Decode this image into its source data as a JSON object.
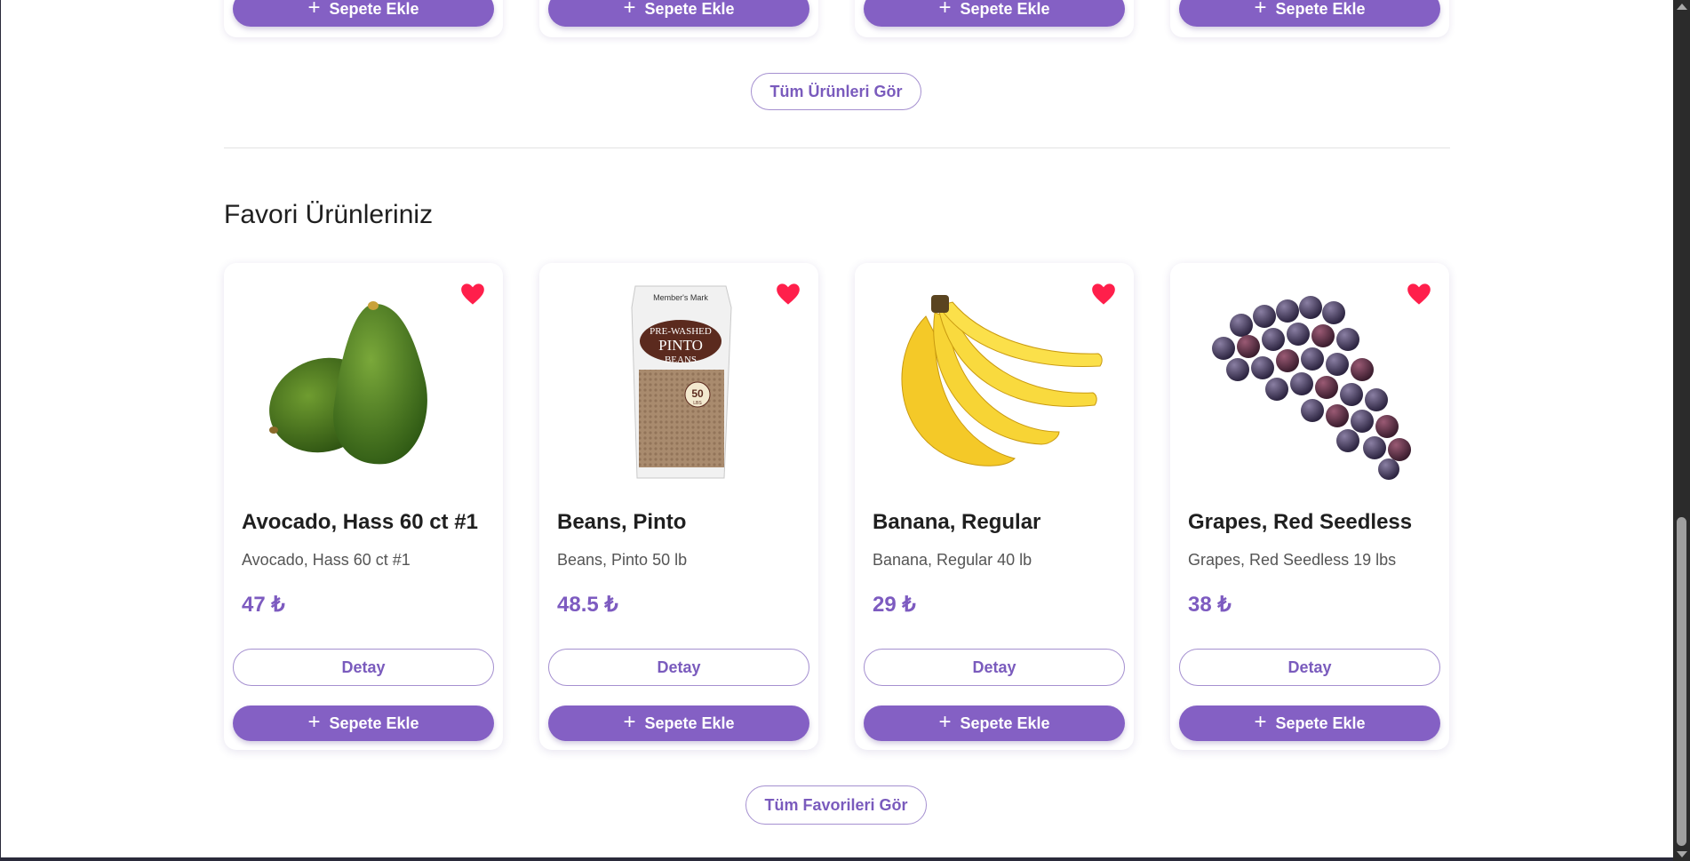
{
  "top_products": {
    "cart_buttons": [
      "Sepete Ekle",
      "Sepete Ekle",
      "Sepete Ekle",
      "Sepete Ekle"
    ],
    "see_all_label": "Tüm Ürünleri Gör"
  },
  "favorites": {
    "title": "Favori Ürünleriniz",
    "items": [
      {
        "name": "Avocado, Hass 60 ct #1",
        "description": "Avocado, Hass 60 ct #1",
        "price": "47 ₺",
        "detail_label": "Detay",
        "cart_label": "Sepete Ekle"
      },
      {
        "name": "Beans, Pinto",
        "description": "Beans, Pinto 50 lb",
        "price": "48.5 ₺",
        "detail_label": "Detay",
        "cart_label": "Sepete Ekle"
      },
      {
        "name": "Banana, Regular",
        "description": "Banana, Regular 40 lb",
        "price": "29 ₺",
        "detail_label": "Detay",
        "cart_label": "Sepete Ekle"
      },
      {
        "name": "Grapes, Red Seedless",
        "description": "Grapes, Red Seedless 19 lbs",
        "price": "38 ₺",
        "detail_label": "Detay",
        "cart_label": "Sepete Ekle"
      }
    ],
    "see_all_label": "Tüm Favorileri Gör"
  },
  "package_label": {
    "brand": "Member's Mark",
    "line1": "PRE-WASHED",
    "line2": "PINTO",
    "line3": "BEANS",
    "badge": "50",
    "badge_unit": "LBS"
  },
  "colors": {
    "accent": "#8460c4",
    "heart": "#ff1f4b",
    "price": "#7d5bc0"
  },
  "icons": {
    "favorite": "heart-icon",
    "add": "plus-icon"
  }
}
